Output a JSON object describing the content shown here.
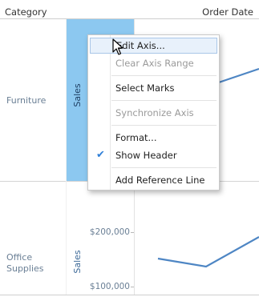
{
  "header": {
    "column_header": "Category",
    "date_header": "Order Date"
  },
  "rows": [
    {
      "category": "Furniture",
      "axis_title": "Sales"
    },
    {
      "category": "Office\nSupplies",
      "axis_title": "Sales",
      "ticks": [
        "$200,000",
        "$100,000"
      ]
    }
  ],
  "context_menu": {
    "items": [
      {
        "label": "Edit Axis...",
        "enabled": true,
        "hovered": true
      },
      {
        "label": "Clear Axis Range",
        "enabled": false
      },
      {
        "label": "Select Marks",
        "enabled": true
      },
      {
        "label": "Synchronize Axis",
        "enabled": false
      },
      {
        "label": "Format...",
        "enabled": true
      },
      {
        "label": "Show Header",
        "enabled": true,
        "checked": true
      },
      {
        "label": "Add Reference Line",
        "enabled": true
      }
    ]
  },
  "colors": {
    "selected_axis": "#8cc8f0",
    "line": "#4e86c4",
    "accent": "#2f7fd8"
  }
}
